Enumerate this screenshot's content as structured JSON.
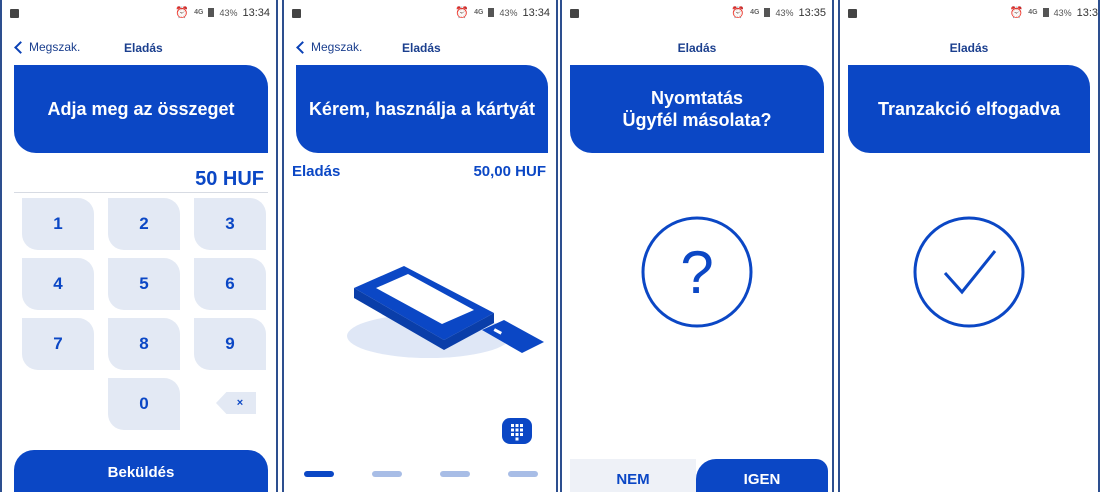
{
  "screens": [
    {
      "status": {
        "time": "13:34",
        "battery": "43%",
        "network": "4G"
      },
      "nav": {
        "back_label": "Megszak.",
        "title": "Eladás"
      },
      "banner": "Adja meg az összeget",
      "amount": "50 HUF",
      "keys": [
        "1",
        "2",
        "3",
        "4",
        "5",
        "6",
        "7",
        "8",
        "9",
        "0"
      ],
      "backspace_symbol": "×",
      "submit_label": "Beküldés"
    },
    {
      "status": {
        "time": "13:34",
        "battery": "43%",
        "network": "4G"
      },
      "nav": {
        "back_label": "Megszak.",
        "title": "Eladás"
      },
      "banner": "Kérem, használja a kártyát",
      "sale_label": "Eladás",
      "sale_amount": "50,00 HUF",
      "icons": [
        "card-terminal-icon",
        "keypad-icon"
      ],
      "progress_step": 1,
      "progress_total": 4
    },
    {
      "status": {
        "time": "13:35",
        "battery": "43%",
        "network": "4G"
      },
      "nav": {
        "title": "Eladás"
      },
      "banner_line1": "Nyomtatás",
      "banner_line2": "Ügyfél másolata?",
      "icon": "question-circle-icon",
      "no_label": "NEM",
      "yes_label": "IGEN"
    },
    {
      "status": {
        "time": "13:3",
        "battery": "43%",
        "network": "4G"
      },
      "nav": {
        "title": "Eladás"
      },
      "banner": "Tranzakció elfogadva",
      "icon": "check-circle-icon"
    }
  ],
  "colors": {
    "primary": "#0b47c5",
    "key_bg": "#e3e9f4",
    "frame": "#2d4f8f"
  }
}
